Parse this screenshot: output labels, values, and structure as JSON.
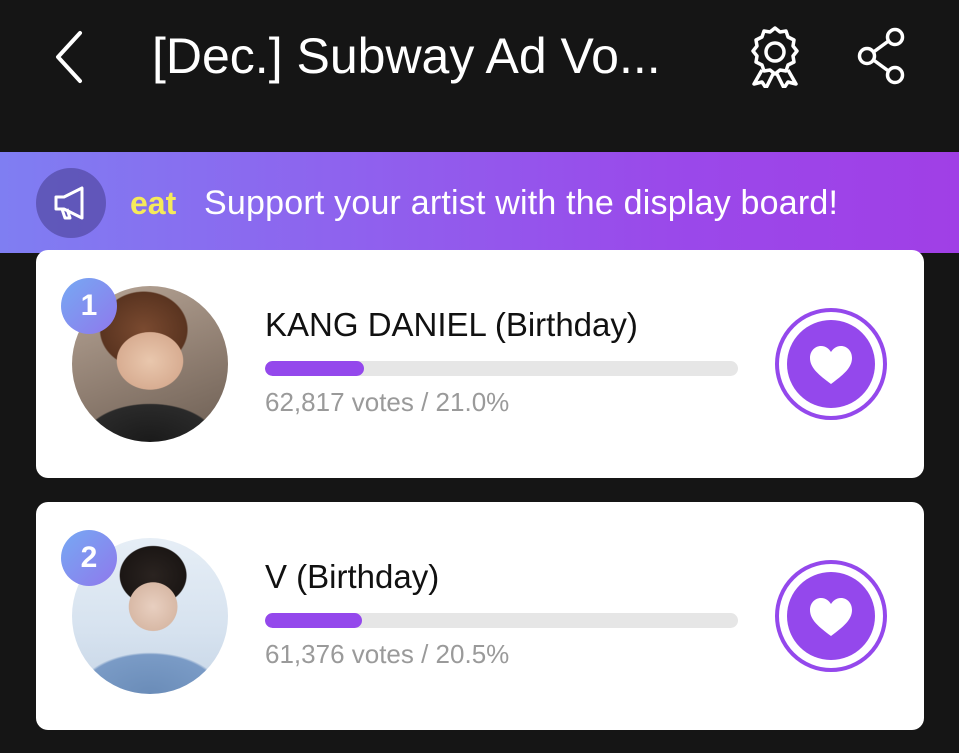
{
  "header": {
    "title": "[Dec.] Subway Ad Vo...",
    "back_icon": "chevron-left-icon",
    "award_icon": "award-ribbon-icon",
    "share_icon": "share-icon"
  },
  "banner": {
    "icon": "megaphone-icon",
    "tag": "eat",
    "text": "Support your artist with the display board!",
    "gradient_colors": [
      "#7f7ef2",
      "#a03fe6"
    ],
    "tag_color": "#f6ea5a"
  },
  "candidates": [
    {
      "rank": "1",
      "name": "KANG DANIEL (Birthday)",
      "votes_text": "62,817 votes / 21.0%",
      "percent": 21.0
    },
    {
      "rank": "2",
      "name": "V (Birthday)",
      "votes_text": "61,376 votes / 20.5%",
      "percent": 20.5
    }
  ],
  "colors": {
    "accent": "#9448ec",
    "background": "#151515",
    "card": "#ffffff"
  }
}
